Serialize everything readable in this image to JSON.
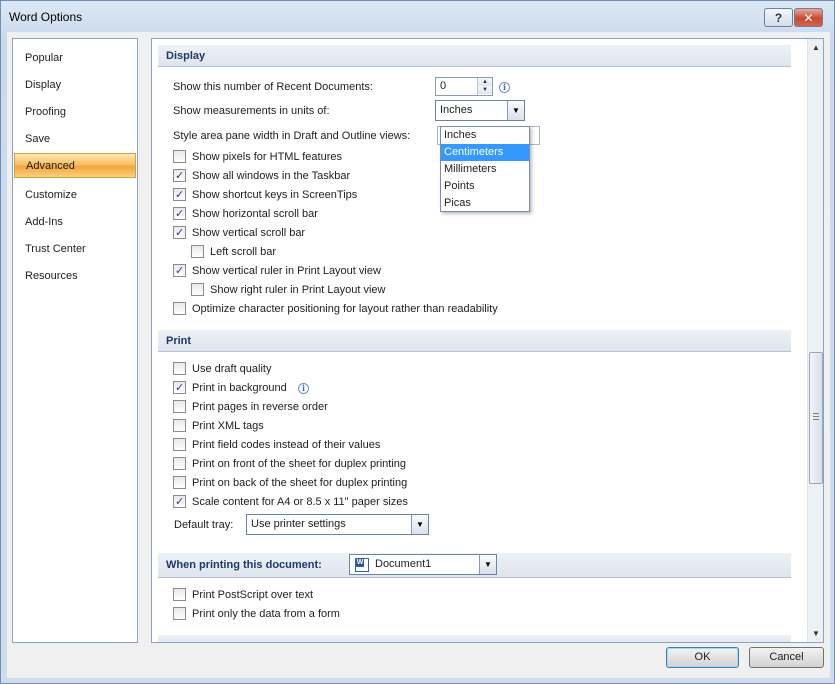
{
  "window": {
    "title": "Word Options",
    "help_glyph": "?",
    "close_glyph": "✕"
  },
  "nav": {
    "items": [
      {
        "label": "Popular",
        "active": false
      },
      {
        "label": "Display",
        "active": false
      },
      {
        "label": "Proofing",
        "active": false
      },
      {
        "label": "Save",
        "active": false
      },
      {
        "label": "Advanced",
        "active": true
      },
      {
        "label": "Customize",
        "active": false
      },
      {
        "label": "Add-Ins",
        "active": false
      },
      {
        "label": "Trust Center",
        "active": false
      },
      {
        "label": "Resources",
        "active": false
      }
    ]
  },
  "display": {
    "header": "Display",
    "recent_docs_label": "Show this number of Recent Documents:",
    "recent_docs_value": "0",
    "units_label": "Show measurements in units of:",
    "units_value": "Inches",
    "style_area_label": "Style area pane width in Draft and Outline views:",
    "units_options": [
      "Inches",
      "Centimeters",
      "Millimeters",
      "Points",
      "Picas"
    ],
    "units_highlighted": "Centimeters",
    "checkboxes": [
      {
        "label": "Show pixels for HTML features",
        "checked": false
      },
      {
        "label": "Show all windows in the Taskbar",
        "checked": true
      },
      {
        "label": "Show shortcut keys in ScreenTips",
        "checked": true
      },
      {
        "label": "Show horizontal scroll bar",
        "checked": true
      },
      {
        "label": "Show vertical scroll bar",
        "checked": true
      },
      {
        "label": "Left scroll bar",
        "checked": false
      },
      {
        "label": "Show vertical ruler in Print Layout view",
        "checked": true
      },
      {
        "label": "Show right ruler in Print Layout view",
        "checked": false
      },
      {
        "label": "Optimize character positioning for layout rather than readability",
        "checked": false
      }
    ]
  },
  "print": {
    "header": "Print",
    "checkboxes": [
      {
        "label": "Use draft quality",
        "checked": false
      },
      {
        "label": "Print in background",
        "checked": true
      },
      {
        "label": "Print pages in reverse order",
        "checked": false
      },
      {
        "label": "Print XML tags",
        "checked": false
      },
      {
        "label": "Print field codes instead of their values",
        "checked": false
      },
      {
        "label": "Print on front of the sheet for duplex printing",
        "checked": false
      },
      {
        "label": "Print on back of the sheet for duplex printing",
        "checked": false
      },
      {
        "label": "Scale content for A4 or 8.5 x 11\" paper sizes",
        "checked": true
      }
    ],
    "default_tray_label": "Default tray:",
    "default_tray_value": "Use printer settings"
  },
  "when_printing": {
    "header": "When printing this document:",
    "document_value": "Document1",
    "checkboxes": [
      {
        "label": "Print PostScript over text",
        "checked": false
      },
      {
        "label": "Print only the data from a form",
        "checked": false
      }
    ]
  },
  "glyphs": {
    "dropdown_arrow": "▼",
    "spin_up": "▲",
    "spin_down": "▼",
    "scroll_up": "▲",
    "scroll_down": "▼",
    "info": "i"
  },
  "buttons": {
    "ok": "OK",
    "cancel": "Cancel"
  }
}
